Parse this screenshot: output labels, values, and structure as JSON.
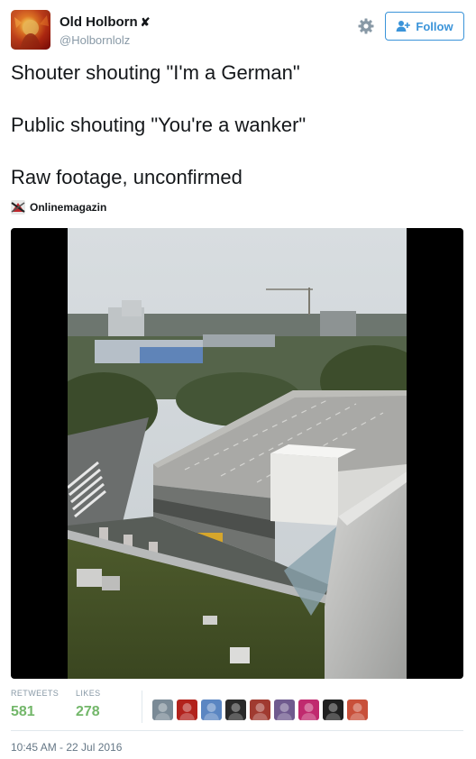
{
  "header": {
    "name": "Old Holborn",
    "name_mark": "✘",
    "handle": "@Holbornlolz",
    "follow_label": "Follow",
    "settings_icon": "gear-icon",
    "follow_icon": "person-plus-icon"
  },
  "tweet": {
    "lines": [
      "Shouter shouting \"I'm a German\"",
      "Public shouting \"You're a wanker\"",
      "Raw footage, unconfirmed"
    ]
  },
  "source": {
    "name": "Onlinemagazin",
    "icon": "onlinemagazin-logo"
  },
  "media": {
    "type": "video-frame",
    "description_icon": "video-thumbnail"
  },
  "stats": {
    "retweets_label": "RETWEETS",
    "retweets_value": "581",
    "likes_label": "LIKES",
    "likes_value": "278"
  },
  "likers": [
    {
      "icon": "avatar-1",
      "color": "#7a8a96"
    },
    {
      "icon": "avatar-2",
      "color": "#b2221c"
    },
    {
      "icon": "avatar-3",
      "color": "#5b86c2"
    },
    {
      "icon": "avatar-4",
      "color": "#2a2a2a"
    },
    {
      "icon": "avatar-5",
      "color": "#a03a30"
    },
    {
      "icon": "avatar-6",
      "color": "#6f5a8e"
    },
    {
      "icon": "avatar-7",
      "color": "#c02a6e"
    },
    {
      "icon": "avatar-8",
      "color": "#202020"
    },
    {
      "icon": "avatar-9",
      "color": "#c8503a"
    }
  ],
  "footer": {
    "timestamp": "10:45 AM - 22 Jul 2016"
  },
  "colors": {
    "accent": "#3b94d9",
    "stat_value": "#73b76a",
    "muted": "#8899a6"
  }
}
